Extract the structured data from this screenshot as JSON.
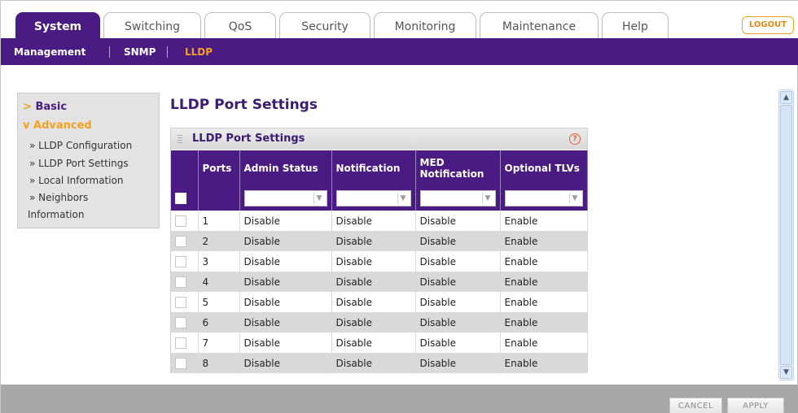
{
  "tabs": [
    {
      "label": "System"
    },
    {
      "label": "Switching"
    },
    {
      "label": "QoS"
    },
    {
      "label": "Security"
    },
    {
      "label": "Monitoring"
    },
    {
      "label": "Maintenance"
    },
    {
      "label": "Help"
    }
  ],
  "logout_label": "LOGOUT",
  "subnav": [
    {
      "label": "Management"
    },
    {
      "label": "SNMP"
    },
    {
      "label": "LLDP"
    }
  ],
  "leftnav": {
    "basic": "Basic",
    "advanced": "Advanced",
    "items": [
      {
        "label": "» LLDP Configuration"
      },
      {
        "label": "» LLDP Port Settings"
      },
      {
        "label": "» Local Information"
      },
      {
        "label": "» Neighbors"
      },
      {
        "label": "Information"
      }
    ]
  },
  "page_title": "LLDP Port Settings",
  "panel": {
    "title": "LLDP Port Settings",
    "help_icon": "?",
    "columns": [
      "Ports",
      "Admin Status",
      "Notification",
      "MED Notification",
      "Optional TLVs"
    ],
    "rows": [
      {
        "port": "1",
        "admin": "Disable",
        "notification": "Disable",
        "med": "Disable",
        "tlvs": "Enable"
      },
      {
        "port": "2",
        "admin": "Disable",
        "notification": "Disable",
        "med": "Disable",
        "tlvs": "Enable"
      },
      {
        "port": "3",
        "admin": "Disable",
        "notification": "Disable",
        "med": "Disable",
        "tlvs": "Enable"
      },
      {
        "port": "4",
        "admin": "Disable",
        "notification": "Disable",
        "med": "Disable",
        "tlvs": "Enable"
      },
      {
        "port": "5",
        "admin": "Disable",
        "notification": "Disable",
        "med": "Disable",
        "tlvs": "Enable"
      },
      {
        "port": "6",
        "admin": "Disable",
        "notification": "Disable",
        "med": "Disable",
        "tlvs": "Enable"
      },
      {
        "port": "7",
        "admin": "Disable",
        "notification": "Disable",
        "med": "Disable",
        "tlvs": "Enable"
      },
      {
        "port": "8",
        "admin": "Disable",
        "notification": "Disable",
        "med": "Disable",
        "tlvs": "Enable"
      }
    ]
  },
  "buttons": {
    "cancel": "CANCEL",
    "apply": "APPLY"
  },
  "colors": {
    "brand_purple": "#4a1b82",
    "accent_orange": "#f3a21f",
    "row_alt": "#d9d9d9"
  }
}
